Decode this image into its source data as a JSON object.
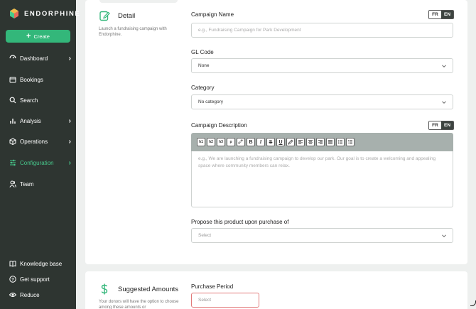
{
  "sidebar": {
    "logo_text": "ENDORPHINE",
    "create_label": "Create",
    "items": [
      {
        "label": "Dashboard",
        "icon": "grid-icon",
        "chevron": true
      },
      {
        "label": "Bookings",
        "icon": "calendar-icon",
        "chevron": false
      },
      {
        "label": "Search",
        "icon": "search-icon",
        "chevron": false
      },
      {
        "label": "Analysis",
        "icon": "bar-chart-icon",
        "chevron": true
      },
      {
        "label": "Operations",
        "icon": "cube-icon",
        "chevron": true
      },
      {
        "label": "Configuration",
        "icon": "sliders-icon",
        "chevron": true,
        "active": true
      },
      {
        "label": "Team",
        "icon": "users-icon",
        "chevron": false
      }
    ],
    "bottom": [
      {
        "label": "Knowledge base",
        "icon": "book-icon"
      },
      {
        "label": "Get support",
        "icon": "help-icon"
      },
      {
        "label": "Reduce",
        "icon": "eye-icon"
      }
    ]
  },
  "detail": {
    "title": "Detail",
    "description": "Launch a fundraising campaign with Endorphine."
  },
  "form": {
    "campaign_name_label": "Campaign Name",
    "campaign_name_placeholder": "e.g., Fundraising Campaign for Park Development",
    "gl_code_label": "GL Code",
    "gl_code_value": "None",
    "category_label": "Category",
    "category_value": "No category",
    "description_label": "Campaign Description",
    "description_placeholder": "e.g., We are launching a fundraising campaign to develop our park. Our goal is to create a welcoming and appealing space where community members can relax.",
    "propose_label": "Propose this product upon purchase of",
    "propose_placeholder": "Select",
    "lang_fr": "FR",
    "lang_en": "EN"
  },
  "toolbar": [
    "h1",
    "h2",
    "h3",
    "p"
  ],
  "suggested": {
    "title": "Suggested Amounts",
    "description": "Your donors will have the option to choose among these amounts or",
    "purchase_period_label": "Purchase Period",
    "purchase_period_placeholder": "Select"
  },
  "colors": {
    "accent": "#33b77a",
    "sidebar": "#2e3531",
    "active": "#47c98c",
    "error": "#e27a7a"
  }
}
